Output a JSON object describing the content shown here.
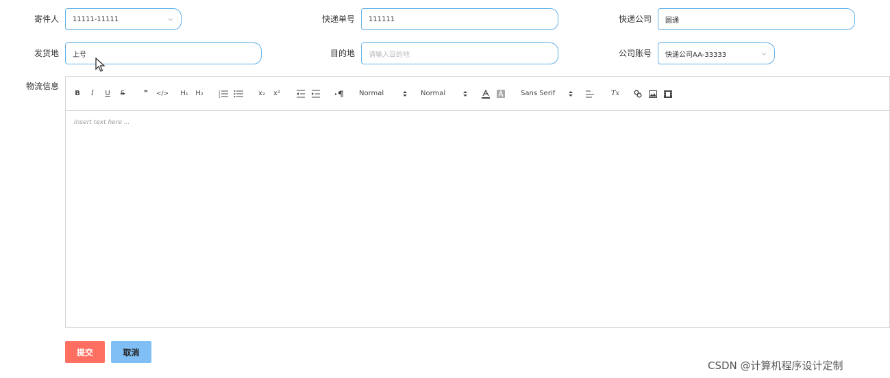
{
  "form": {
    "sender": {
      "label": "寄件人",
      "value": "11111-11111"
    },
    "tracking_no": {
      "label": "快递单号",
      "value": "111111"
    },
    "courier": {
      "label": "快递公司",
      "value": "圆通"
    },
    "origin": {
      "label": "发货地",
      "value": "上号"
    },
    "destination": {
      "label": "目的地",
      "placeholder": "请输入目的地"
    },
    "account": {
      "label": "公司账号",
      "value": "快递公司AA-33333"
    },
    "logistics": {
      "label": "物流信息"
    }
  },
  "editor": {
    "toolbar": {
      "bold": "B",
      "italic": "I",
      "underline": "U",
      "strike": "S",
      "blockquote": "❞",
      "code": "</>",
      "h1": "H₁",
      "h2": "H₂",
      "sub": "x₂",
      "sup": "x²",
      "size_select": "Normal",
      "header_select": "Normal",
      "font_select": "Sans Serif",
      "clean": "Tx"
    },
    "placeholder": "Insert text here ..."
  },
  "buttons": {
    "submit": "提交",
    "cancel": "取消"
  },
  "watermark": "CSDN @计算机程序设计定制",
  "colors": {
    "border_active": "#5fb0e8",
    "submit_bg": "#ff6f61",
    "cancel_bg": "#7fbff5"
  }
}
